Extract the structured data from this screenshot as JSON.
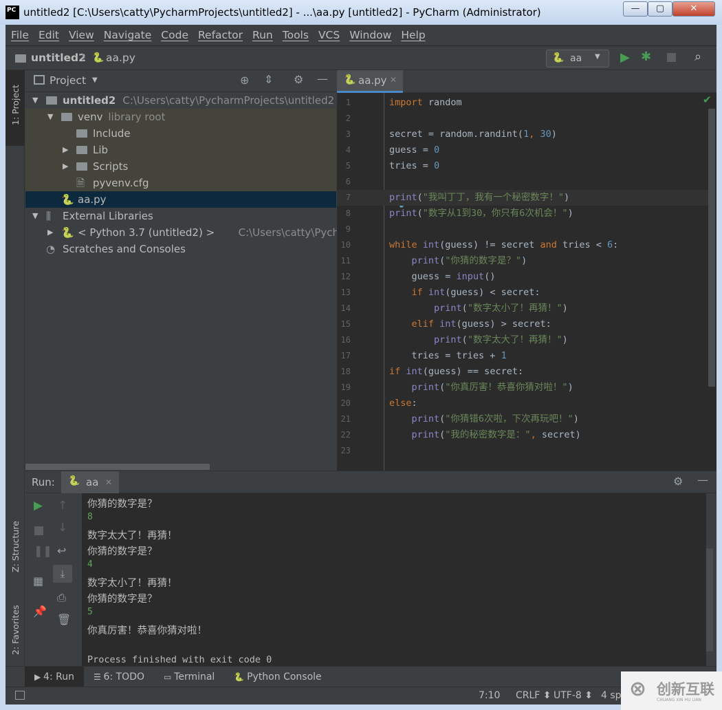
{
  "window": {
    "title": "untitled2 [C:\\Users\\catty\\PycharmProjects\\untitled2] - ...\\aa.py [untitled2] - PyCharm (Administrator)",
    "app_icon": "PC",
    "minimize": "—",
    "maximize": "▢",
    "close": "✕"
  },
  "menu": [
    "File",
    "Edit",
    "View",
    "Navigate",
    "Code",
    "Refactor",
    "Run",
    "Tools",
    "VCS",
    "Window",
    "Help"
  ],
  "nav": {
    "project": "untitled2",
    "file": "aa.py",
    "run_config": "aa"
  },
  "left_strip": {
    "project": "1: Project",
    "structure": "Z: Structure",
    "favorites": "2: Favorites"
  },
  "project_panel": {
    "title": "Project",
    "tree": [
      {
        "label": "untitled2",
        "hint": "C:\\Users\\catty\\PycharmProjects\\untitled2",
        "arrow": "▼",
        "depth": 0,
        "icon": "folder",
        "bold": true
      },
      {
        "label": "venv",
        "hint": "library root",
        "arrow": "▼",
        "depth": 1,
        "icon": "folder"
      },
      {
        "label": "Include",
        "hint": "",
        "arrow": "",
        "depth": 2,
        "icon": "folder"
      },
      {
        "label": "Lib",
        "hint": "",
        "arrow": "▶",
        "depth": 2,
        "icon": "folder"
      },
      {
        "label": "Scripts",
        "hint": "",
        "arrow": "▶",
        "depth": 2,
        "icon": "folder"
      },
      {
        "label": "pyvenv.cfg",
        "hint": "",
        "arrow": "",
        "depth": 2,
        "icon": "file"
      },
      {
        "label": "aa.py",
        "hint": "",
        "arrow": "",
        "depth": 1,
        "icon": "python",
        "selected": true
      },
      {
        "label": "External Libraries",
        "hint": "",
        "arrow": "▼",
        "depth": 0,
        "icon": "library"
      },
      {
        "label": "< Python 3.7 (untitled2) >",
        "hint": "C:\\Users\\catty\\PycharmPr",
        "arrow": "▶",
        "depth": 1,
        "icon": "python"
      },
      {
        "label": "Scratches and Consoles",
        "hint": "",
        "arrow": "",
        "depth": 0,
        "icon": "scratch"
      }
    ]
  },
  "editor": {
    "tab": "aa.py",
    "lines": [
      [
        [
          "kw",
          "import"
        ],
        [
          "plain",
          " random"
        ]
      ],
      [],
      [
        [
          "plain",
          "secret = random.randint("
        ],
        [
          "num",
          "1"
        ],
        [
          "kw",
          ", "
        ],
        [
          "num",
          "30"
        ],
        [
          "plain",
          ")"
        ]
      ],
      [
        [
          "plain",
          "guess = "
        ],
        [
          "num",
          "0"
        ]
      ],
      [
        [
          "plain",
          "tries = "
        ],
        [
          "num",
          "0"
        ]
      ],
      [],
      [
        [
          "bi",
          "print"
        ],
        [
          "plain",
          "("
        ],
        [
          "str",
          "\"我叫丁丁，我有一个秘密数字！\""
        ],
        [
          "plain",
          ")"
        ]
      ],
      [
        [
          "bi",
          "print"
        ],
        [
          "plain",
          "("
        ],
        [
          "str",
          "\"数字从1到30，你只有6次机会！\""
        ],
        [
          "plain",
          ")"
        ]
      ],
      [],
      [
        [
          "kw",
          "while "
        ],
        [
          "bi",
          "int"
        ],
        [
          "plain",
          "(guess) != secret "
        ],
        [
          "kw",
          "and"
        ],
        [
          "plain",
          " tries < "
        ],
        [
          "num",
          "6"
        ],
        [
          "plain",
          ":"
        ]
      ],
      [
        [
          "plain",
          "    "
        ],
        [
          "bi",
          "print"
        ],
        [
          "plain",
          "("
        ],
        [
          "str",
          "\"你猜的数字是？\""
        ],
        [
          "plain",
          ")"
        ]
      ],
      [
        [
          "plain",
          "    guess = "
        ],
        [
          "bi",
          "input"
        ],
        [
          "plain",
          "()"
        ]
      ],
      [
        [
          "plain",
          "    "
        ],
        [
          "kw",
          "if "
        ],
        [
          "bi",
          "int"
        ],
        [
          "plain",
          "(guess) < secret:"
        ]
      ],
      [
        [
          "plain",
          "        "
        ],
        [
          "bi",
          "print"
        ],
        [
          "plain",
          "("
        ],
        [
          "str",
          "\"数字太小了！再猜！\""
        ],
        [
          "plain",
          ")"
        ]
      ],
      [
        [
          "plain",
          "    "
        ],
        [
          "kw",
          "elif "
        ],
        [
          "bi",
          "int"
        ],
        [
          "plain",
          "(guess) > secret:"
        ]
      ],
      [
        [
          "plain",
          "        "
        ],
        [
          "bi",
          "print"
        ],
        [
          "plain",
          "("
        ],
        [
          "str",
          "\"数字太大了！再猜！\""
        ],
        [
          "plain",
          ")"
        ]
      ],
      [
        [
          "plain",
          "    tries = tries + "
        ],
        [
          "num",
          "1"
        ]
      ],
      [
        [
          "kw",
          "if "
        ],
        [
          "bi",
          "int"
        ],
        [
          "plain",
          "(guess) == secret:"
        ]
      ],
      [
        [
          "plain",
          "    "
        ],
        [
          "bi",
          "print"
        ],
        [
          "plain",
          "("
        ],
        [
          "str",
          "\"你真厉害！恭喜你猜对啦！\""
        ],
        [
          "plain",
          ")"
        ]
      ],
      [
        [
          "kw",
          "else"
        ],
        [
          "plain",
          ":"
        ]
      ],
      [
        [
          "plain",
          "    "
        ],
        [
          "bi",
          "print"
        ],
        [
          "plain",
          "("
        ],
        [
          "str",
          "\"你猜错6次啦，下次再玩吧！\""
        ],
        [
          "plain",
          ")"
        ]
      ],
      [
        [
          "plain",
          "    "
        ],
        [
          "bi",
          "print"
        ],
        [
          "plain",
          "("
        ],
        [
          "str",
          "\"我的秘密数字是：\""
        ],
        [
          "kw",
          ", "
        ],
        [
          "plain",
          "secret)"
        ]
      ],
      []
    ]
  },
  "run": {
    "label": "Run:",
    "tab": "aa",
    "console": [
      {
        "t": "out",
        "text": "你猜的数字是？"
      },
      {
        "t": "in",
        "text": "8"
      },
      {
        "t": "out",
        "text": "数字太大了！再猜！"
      },
      {
        "t": "out",
        "text": "你猜的数字是？"
      },
      {
        "t": "in",
        "text": "4"
      },
      {
        "t": "out",
        "text": "数字太小了！再猜！"
      },
      {
        "t": "out",
        "text": "你猜的数字是？"
      },
      {
        "t": "in",
        "text": "5"
      },
      {
        "t": "out",
        "text": "你真厉害！恭喜你猜对啦！"
      },
      {
        "t": "out",
        "text": ""
      },
      {
        "t": "mono",
        "text": "Process finished with exit code 0"
      }
    ]
  },
  "bottom_tabs": [
    "4: Run",
    "6: TODO",
    "Terminal",
    "Python Console"
  ],
  "status": {
    "position": "7:10",
    "line_sep": "CRLF ⬍",
    "encoding": "UTF-8 ⬍",
    "indent": "4 sp"
  },
  "watermark": {
    "text": "创新互联",
    "sub": "CHUANG XIN HU LIAN"
  },
  "colors": {
    "keyword": "#cc7832",
    "builtin": "#8888c6",
    "number": "#6897bb",
    "string": "#6a8759",
    "run_green": "#499c54",
    "selection": "#0d293e"
  }
}
